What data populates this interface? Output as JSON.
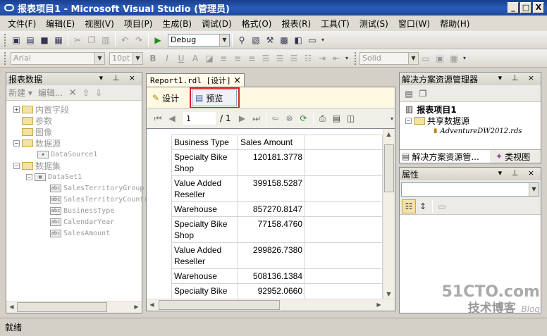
{
  "window": {
    "title": "报表项目1 - Microsoft Visual Studio (管理员)",
    "min": "_",
    "max": "□",
    "close": "X"
  },
  "menu": [
    "文件(F)",
    "编辑(E)",
    "视图(V)",
    "项目(P)",
    "生成(B)",
    "调试(D)",
    "格式(O)",
    "报表(R)",
    "工具(T)",
    "测试(S)",
    "窗口(W)",
    "帮助(H)"
  ],
  "toolbar": {
    "config": "Debug",
    "font": "Arial",
    "size": "10pt",
    "bold": "B",
    "italic": "I",
    "underline": "U",
    "border": "Solid"
  },
  "report_data": {
    "title": "报表数据",
    "new_label": "新建 ▾",
    "edit_label": "编辑...",
    "tree": [
      {
        "label": "内置字段",
        "level": 0,
        "kind": "folder",
        "exp": "+"
      },
      {
        "label": "参数",
        "level": 0,
        "kind": "folder",
        "exp": ""
      },
      {
        "label": "图像",
        "level": 0,
        "kind": "folder",
        "exp": ""
      },
      {
        "label": "数据源",
        "level": 0,
        "kind": "folder",
        "exp": "−"
      },
      {
        "label": "DataSource1",
        "level": 1,
        "kind": "ds",
        "exp": ""
      },
      {
        "label": "数据集",
        "level": 0,
        "kind": "folder",
        "exp": "−"
      },
      {
        "label": "DataSet1",
        "level": 1,
        "kind": "ds",
        "exp": "−"
      },
      {
        "label": "SalesTerritoryGroup",
        "level": 2,
        "kind": "field",
        "exp": ""
      },
      {
        "label": "SalesTerritoryCountry",
        "level": 2,
        "kind": "field",
        "exp": ""
      },
      {
        "label": "BusinessType",
        "level": 2,
        "kind": "field",
        "exp": ""
      },
      {
        "label": "CalendarYear",
        "level": 2,
        "kind": "field",
        "exp": ""
      },
      {
        "label": "SalesAmount",
        "level": 2,
        "kind": "field",
        "exp": ""
      }
    ]
  },
  "document": {
    "tab": "Report1.rdl [设计]",
    "design_tab": "设计",
    "preview_tab": "预览",
    "page": "1",
    "of_pages": "/ 1",
    "table": {
      "headers": [
        "Business Type",
        "Sales Amount"
      ],
      "rows": [
        [
          "Specialty Bike Shop",
          "120181.3778"
        ],
        [
          "Value Added Reseller",
          "399158.5287"
        ],
        [
          "Warehouse",
          "857270.8147"
        ],
        [
          "Specialty Bike Shop",
          "77158.4760"
        ],
        [
          "Value Added Reseller",
          "299826.7380"
        ],
        [
          "Warehouse",
          "508136.1384"
        ],
        [
          "Specialty Bike Shop",
          "92952.0660"
        ]
      ]
    }
  },
  "solution_explorer": {
    "title": "解决方案资源管理器",
    "project": "报表项目1",
    "shared": "共享数据源",
    "ds_file": "AdventureDW2012.rds",
    "tab1": "解决方案资源管...",
    "tab2": "类视图"
  },
  "properties": {
    "title": "属性"
  },
  "status": "就绪",
  "watermark": {
    "site": "51CTO.com",
    "line2": "技术博客",
    "blog": "Blog"
  }
}
